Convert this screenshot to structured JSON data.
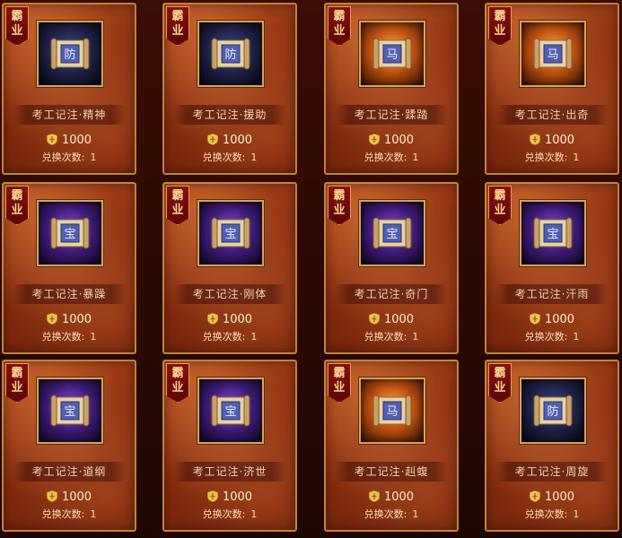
{
  "badge": {
    "line1": "霸",
    "line2": "业"
  },
  "redeem_label": "兑换次数:",
  "cards": [
    {
      "title": "考工记注·精神",
      "price": "1000",
      "redeem_count": "1",
      "bg": "dark",
      "glyph": "防"
    },
    {
      "title": "考工记注·援助",
      "price": "1000",
      "redeem_count": "1",
      "bg": "dark",
      "glyph": "防"
    },
    {
      "title": "考工记注·蹂踏",
      "price": "1000",
      "redeem_count": "1",
      "bg": "fire",
      "glyph": "马"
    },
    {
      "title": "考工记注·出奇",
      "price": "1000",
      "redeem_count": "1",
      "bg": "fire",
      "glyph": "马"
    },
    {
      "title": "考工记注·暴躁",
      "price": "1000",
      "redeem_count": "1",
      "bg": "purple",
      "glyph": "宝"
    },
    {
      "title": "考工记注·刚体",
      "price": "1000",
      "redeem_count": "1",
      "bg": "purple",
      "glyph": "宝"
    },
    {
      "title": "考工记注·奇门",
      "price": "1000",
      "redeem_count": "1",
      "bg": "purple",
      "glyph": "宝"
    },
    {
      "title": "考工记注·汗雨",
      "price": "1000",
      "redeem_count": "1",
      "bg": "purple",
      "glyph": "宝"
    },
    {
      "title": "考工记注·道纲",
      "price": "1000",
      "redeem_count": "1",
      "bg": "purple",
      "glyph": "宝"
    },
    {
      "title": "考工记注·济世",
      "price": "1000",
      "redeem_count": "1",
      "bg": "purple",
      "glyph": "宝"
    },
    {
      "title": "考工记注·赳蝮",
      "price": "1000",
      "redeem_count": "1",
      "bg": "fire",
      "glyph": "马"
    },
    {
      "title": "考工记注·周旋",
      "price": "1000",
      "redeem_count": "1",
      "bg": "dark",
      "glyph": "防"
    }
  ]
}
